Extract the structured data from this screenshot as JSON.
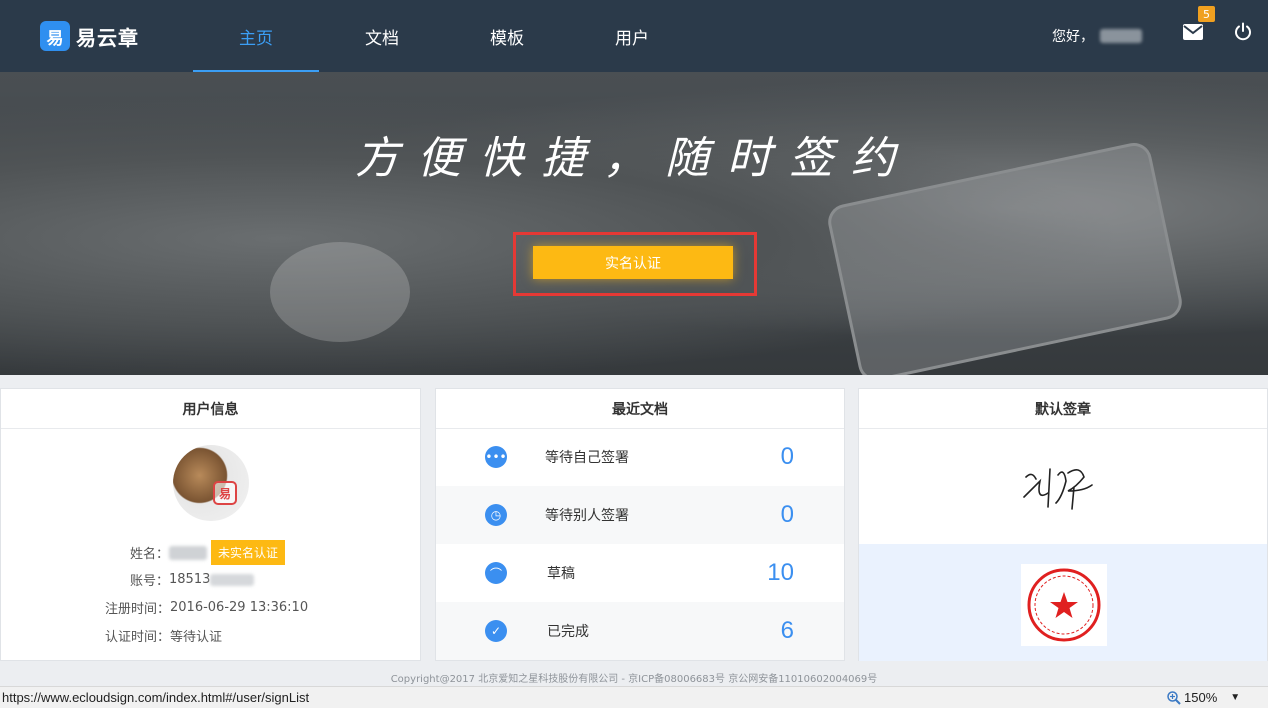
{
  "brand": {
    "logo_mark": "易",
    "name": "易云章"
  },
  "nav": {
    "items": [
      {
        "label": "主页",
        "active": true
      },
      {
        "label": "文档",
        "active": false
      },
      {
        "label": "模板",
        "active": false
      },
      {
        "label": "用户",
        "active": false
      }
    ],
    "greeting": "您好，",
    "mail_badge": "5"
  },
  "hero": {
    "slogan": "方便快捷，随时签约",
    "cta_label": "实名认证"
  },
  "user_info": {
    "title": "用户信息",
    "name_label": "姓名：",
    "verify_badge": "未实名认证",
    "account_label": "账号：",
    "account_value": "18513",
    "register_label": "注册时间：",
    "register_value": "2016-06-29 13:36:10",
    "cert_label": "认证时间：",
    "cert_value": "等待认证"
  },
  "recent_docs": {
    "title": "最近文档",
    "items": [
      {
        "label": "等待自己签署",
        "count": "0",
        "icon": "chat-bubble-icon"
      },
      {
        "label": "等待别人签署",
        "count": "0",
        "icon": "alarm-clock-icon"
      },
      {
        "label": "草稿",
        "count": "10",
        "icon": "draft-icon"
      },
      {
        "label": "已完成",
        "count": "6",
        "icon": "check-circle-icon"
      }
    ]
  },
  "default_seal": {
    "title": "默认签章"
  },
  "footer": {
    "copyright": "Copyright@2017 北京爱知之星科技股份有限公司 - 京ICP备08006683号 京公网安备11010602004069号"
  },
  "statusbar": {
    "url": "https://www.ecloudsign.com/index.html#/user/signList",
    "zoom": "150%"
  },
  "colors": {
    "nav_bg": "#2b3a4a",
    "accent_blue": "#3b9ef5",
    "cta_yellow": "#fdb913",
    "highlight_red": "#e53935"
  }
}
